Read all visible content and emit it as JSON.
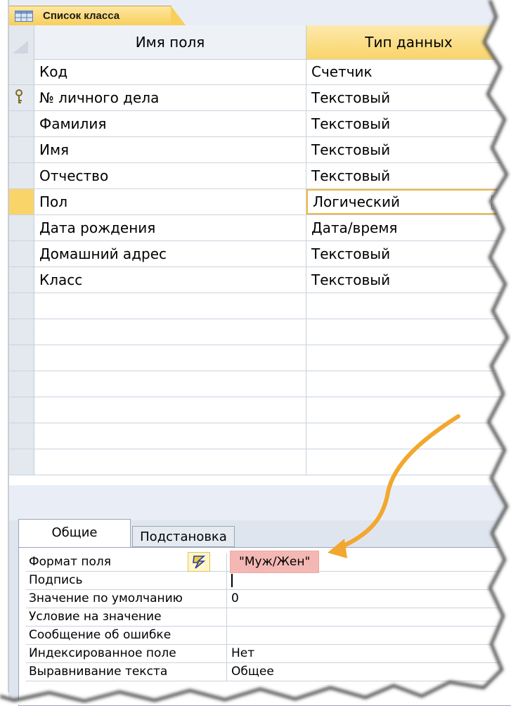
{
  "document_tab": {
    "label": "Список класса",
    "icon": "table-icon"
  },
  "grid": {
    "headers": {
      "field_name": "Имя поля",
      "data_type": "Тип данных"
    },
    "rows": [
      {
        "name": "Код",
        "type": "Счетчик",
        "key": false,
        "current": false
      },
      {
        "name": "№ личного дела",
        "type": "Текстовый",
        "key": true,
        "current": false
      },
      {
        "name": "Фамилия",
        "type": "Текстовый",
        "key": false,
        "current": false
      },
      {
        "name": "Имя",
        "type": "Текстовый",
        "key": false,
        "current": false
      },
      {
        "name": "Отчество",
        "type": "Текстовый",
        "key": false,
        "current": false
      },
      {
        "name": "Пол",
        "type": "Логический",
        "key": false,
        "current": true
      },
      {
        "name": "Дата рождения",
        "type": "Дата/время",
        "key": false,
        "current": false
      },
      {
        "name": "Домашний адрес",
        "type": "Текстовый",
        "key": false,
        "current": false
      },
      {
        "name": "Класс",
        "type": "Текстовый",
        "key": false,
        "current": false
      },
      {
        "name": "",
        "type": "",
        "key": false,
        "current": false
      },
      {
        "name": "",
        "type": "",
        "key": false,
        "current": false
      },
      {
        "name": "",
        "type": "",
        "key": false,
        "current": false
      },
      {
        "name": "",
        "type": "",
        "key": false,
        "current": false
      },
      {
        "name": "",
        "type": "",
        "key": false,
        "current": false
      },
      {
        "name": "",
        "type": "",
        "key": false,
        "current": false
      },
      {
        "name": "",
        "type": "",
        "key": false,
        "current": false
      }
    ]
  },
  "properties": {
    "tabs": {
      "general": "Общие",
      "lookup": "Подстановка"
    },
    "rows": [
      {
        "label": "Формат поля",
        "value": "\"Муж/Жен\""
      },
      {
        "label": "Подпись",
        "value": ""
      },
      {
        "label": "Значение по умолчанию",
        "value": "0"
      },
      {
        "label": "Условие на значение",
        "value": ""
      },
      {
        "label": "Сообщение об ошибке",
        "value": ""
      },
      {
        "label": "Индексированное поле",
        "value": "Нет"
      },
      {
        "label": "Выравнивание текста",
        "value": "Общее"
      }
    ]
  },
  "colors": {
    "accent": "#f9d468",
    "annotation_arrow": "#f2a72e",
    "format_highlight": "#f4b8b4",
    "grid_lines": "#c9d3df"
  }
}
